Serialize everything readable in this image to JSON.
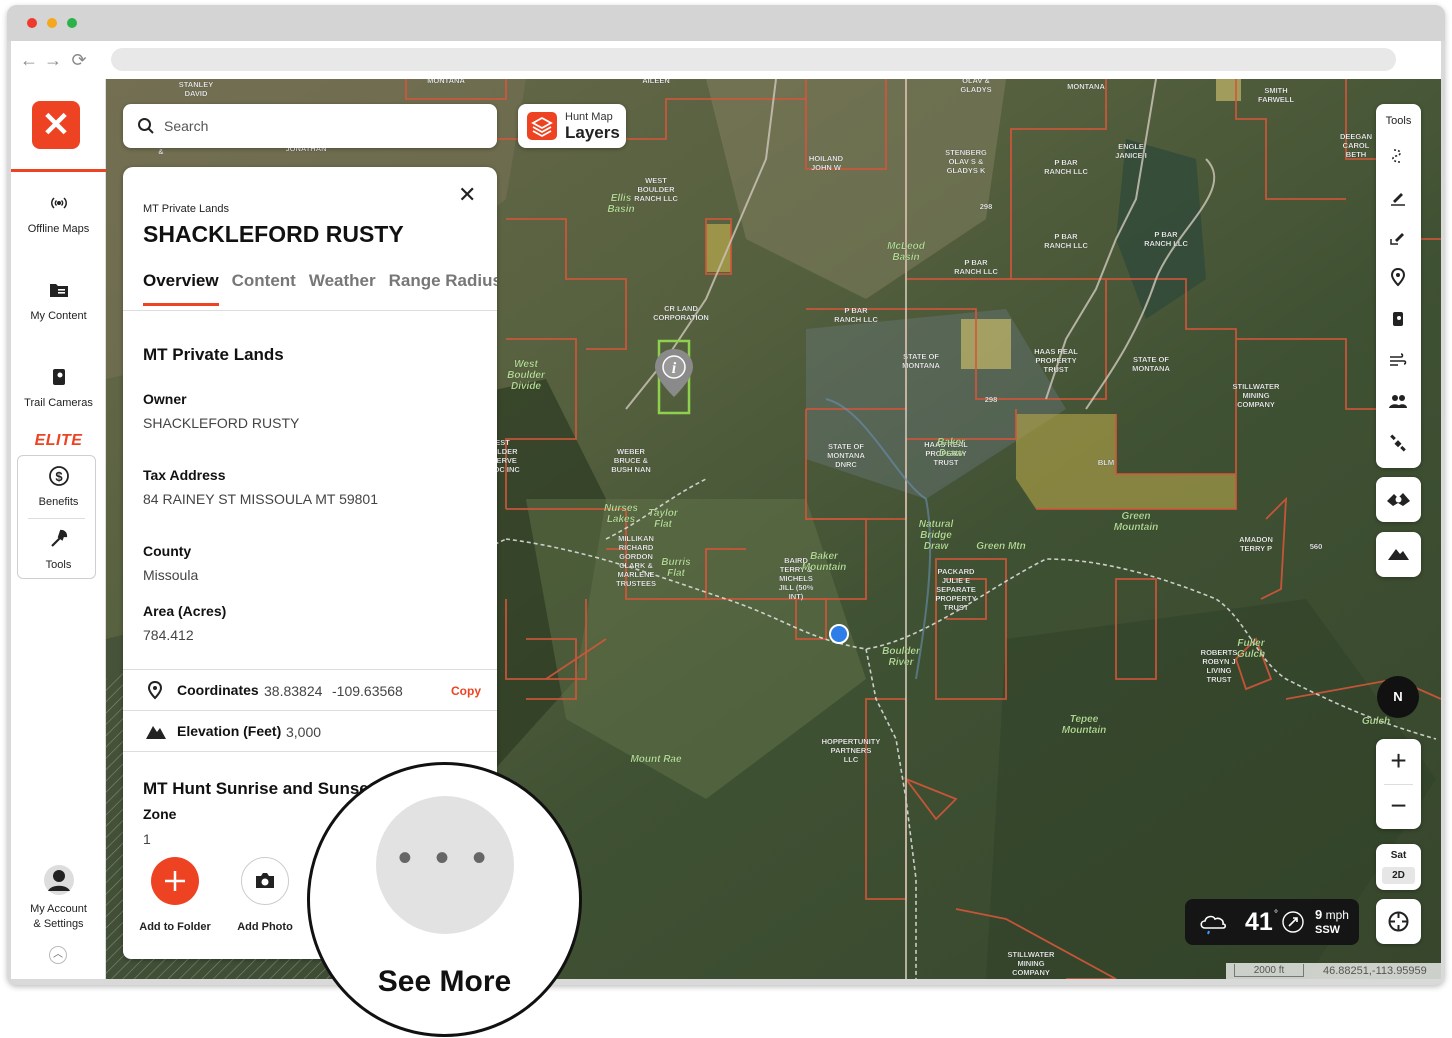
{
  "sidebar": {
    "items": [
      {
        "label": "Offline Maps",
        "icon": "offline-maps-icon"
      },
      {
        "label": "My Content",
        "icon": "folder-icon"
      },
      {
        "label": "Trail Cameras",
        "icon": "trail-camera-icon"
      }
    ],
    "elite_label": "ELITE",
    "elite_items": [
      {
        "label": "Benefits",
        "icon": "dollar-circle-icon"
      },
      {
        "label": "Tools",
        "icon": "tools-icon"
      }
    ],
    "account": {
      "line1": "My Account",
      "line2": "& Settings"
    },
    "accent": "#ee4322"
  },
  "search": {
    "placeholder": "Search"
  },
  "layers": {
    "small": "Hunt Map",
    "big": "Layers"
  },
  "panel": {
    "category": "MT Private Lands",
    "title": "SHACKLEFORD RUSTY",
    "tabs": [
      "Overview",
      "Content",
      "Weather",
      "Range Radius"
    ],
    "section_title": "MT Private Lands",
    "owner_label": "Owner",
    "owner_value": "SHACKLEFORD RUSTY",
    "tax_label": "Tax Address",
    "tax_value": "84 RAINEY ST MISSOULA MT 59801",
    "county_label": "County",
    "county_value": "Missoula",
    "area_label": "Area (Acres)",
    "area_value": "784.412",
    "coords_label": "Coordinates",
    "coords_lat": "38.83824",
    "coords_lon": "-109.63568",
    "copy_label": "Copy",
    "elev_label": "Elevation (Feet)",
    "elev_value": "3,000",
    "sun_title": "MT Hunt Sunrise and Sunset",
    "zone_label": "Zone",
    "zone_value": "1",
    "add_folder": "Add to Folder",
    "add_photo": "Add Photo"
  },
  "see_more": {
    "label": "See More"
  },
  "tools": {
    "label": "Tools"
  },
  "compass": {
    "label": "N"
  },
  "map_mode": {
    "type": "Sat",
    "dim": "2D"
  },
  "weather": {
    "temp": "41",
    "deg": "°",
    "wind_speed": "9",
    "wind_unit": "mph",
    "wind_dir": "SSW"
  },
  "scale": {
    "distance": "2000 ft",
    "coords": "46.88251,-113.95959"
  },
  "map_labels": [
    {
      "text": "STANLEY DAVID"
    },
    {
      "text": "MONTANA"
    },
    {
      "text": "AILEEN"
    },
    {
      "text": "OLAV & GLADYS"
    },
    {
      "text": "MONTANA"
    },
    {
      "text": "SMITH FARWELL"
    },
    {
      "text": "DEEGAN CAROL BETH"
    },
    {
      "text": "BANNUS B &"
    },
    {
      "text": "JONATHAN"
    },
    {
      "text": "HOILAND JOHN W"
    },
    {
      "text": "STENBERG OLAV S & GLADYS K"
    },
    {
      "text": "P BAR RANCH LLC"
    },
    {
      "text": "ENGLE JANICE I"
    },
    {
      "text": "WEST BOULDER RANCH LLC"
    },
    {
      "text": "Ellis Basin"
    },
    {
      "text": "McLeod Basin"
    },
    {
      "text": "P BAR RANCH LLC"
    },
    {
      "text": "P BAR RANCH LLC"
    },
    {
      "text": "P BAR RANCH LLC"
    },
    {
      "text": "CR LAND CORPORATION"
    },
    {
      "text": "P BAR RANCH LLC"
    },
    {
      "text": "West Boulder Divide"
    },
    {
      "text": "STATE OF MONTANA"
    },
    {
      "text": "HAAS REAL PROPERTY TRUST"
    },
    {
      "text": "STATE OF MONTANA"
    },
    {
      "text": "STILLWATER MINING COMPANY"
    },
    {
      "text": "STATE OF MONTANA DNRC"
    },
    {
      "text": "HAAS REAL PROPERTY TRUST"
    },
    {
      "text": "Baker Draw"
    },
    {
      "text": "BLM"
    },
    {
      "text": "WEBER BRUCE & BUSH NAN"
    },
    {
      "text": "WEST BOULDER RESERVE ASSOC INC"
    },
    {
      "text": "Nurses Lakes"
    },
    {
      "text": "Taylor Flat"
    },
    {
      "text": "Natural Bridge Draw"
    },
    {
      "text": "Green Mountain"
    },
    {
      "text": "AMADON TERRY P"
    },
    {
      "text": "MILLIKAN RICHARD GORDON CLARK & MARLENE TRUSTEES"
    },
    {
      "text": "Burris Flat"
    },
    {
      "text": "BAIRD TERRY & MICHELS JILL (50% INT)"
    },
    {
      "text": "Baker Mountain"
    },
    {
      "text": "PACKARD JULIE E SEPARATE PROPERTY TRUST"
    },
    {
      "text": "560"
    },
    {
      "text": "Boulder River"
    },
    {
      "text": "ROBERTS ROBYN J LIVING TRUST"
    },
    {
      "text": "Fuller Gulch"
    },
    {
      "text": "Tepee Mountain"
    },
    {
      "text": "HOPPERTUNITY PARTNERS LLC"
    },
    {
      "text": "Mount Rae"
    },
    {
      "text": "STILLWATER MINING COMPANY"
    },
    {
      "text": "298"
    },
    {
      "text": "298"
    },
    {
      "text": "Gulch"
    },
    {
      "text": "Green Mtn"
    }
  ]
}
